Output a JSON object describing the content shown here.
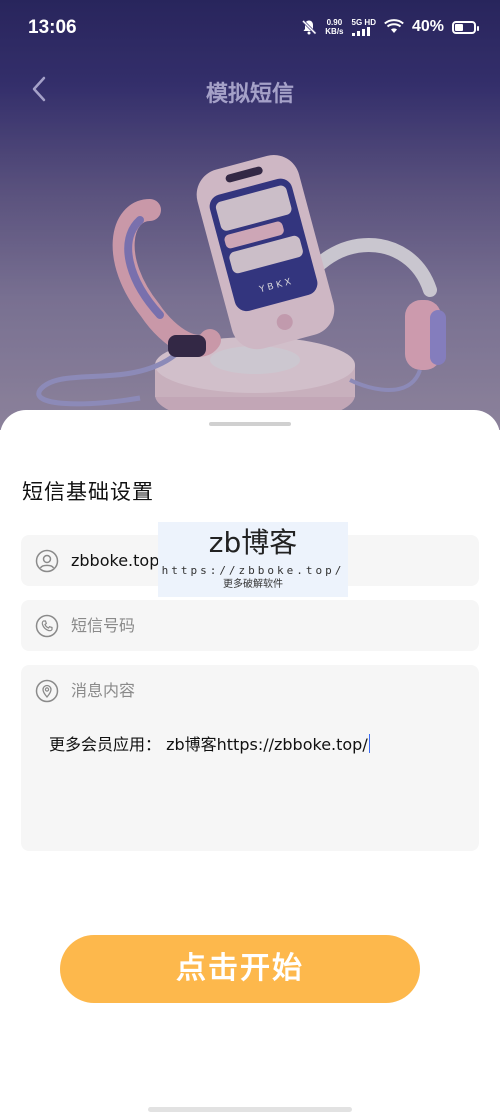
{
  "status_bar": {
    "time": "13:06",
    "speed_value": "0.90",
    "speed_unit": "KB/s",
    "network": "5G HD",
    "battery": "40%"
  },
  "nav": {
    "title": "模拟短信",
    "back_icon": "chevron-left-icon"
  },
  "form": {
    "section_title": "短信基础设置",
    "sender_value": "zbboke.top",
    "sender_icon": "user-icon",
    "phone_placeholder": "短信号码",
    "phone_icon": "phone-icon",
    "content_placeholder": "消息内容",
    "content_icon": "location-pin-icon",
    "content_value": "更多会员应用： zb博客https://zbboke.top/"
  },
  "watermark": {
    "title": "zb博客",
    "url": "https://zbboke.top/",
    "subtitle": "更多破解软件"
  },
  "start_button": "点击开始",
  "colors": {
    "accent": "#fdb84c",
    "field_bg": "#f6f6f6",
    "hero_top": "#2d2a66",
    "caret": "#3a6cf5"
  }
}
